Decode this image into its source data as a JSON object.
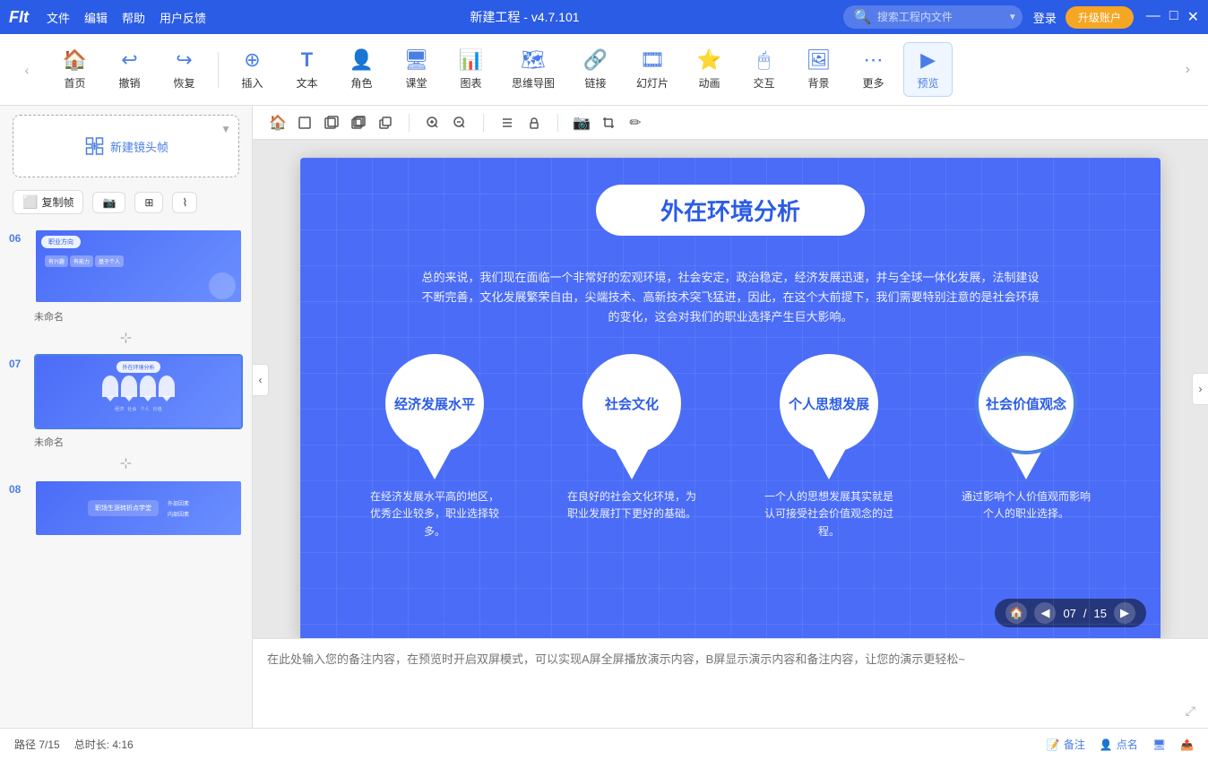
{
  "app": {
    "logo": "FIt",
    "title": "新建工程 - v4.7.101",
    "search_placeholder": "搜索工程内文件",
    "login": "登录",
    "upgrade": "升级账户"
  },
  "window_controls": {
    "minimize": "—",
    "maximize": "□",
    "close": "✕"
  },
  "toolbar": {
    "back": "‹",
    "forward": "›",
    "home_icon": "🏠",
    "home_label": "首页",
    "undo_icon": "↩",
    "undo_label": "撤销",
    "redo_icon": "↪",
    "redo_label": "恢复",
    "insert_icon": "⊕",
    "insert_label": "插入",
    "text_icon": "T",
    "text_label": "文本",
    "character_icon": "👤",
    "character_label": "角色",
    "class_icon": "🖥",
    "class_label": "课堂",
    "chart_icon": "📊",
    "chart_label": "图表",
    "mindmap_icon": "🗺",
    "mindmap_label": "思维导图",
    "link_icon": "🔗",
    "link_label": "链接",
    "slide_icon": "🎞",
    "slide_label": "幻灯片",
    "animation_icon": "⭐",
    "animation_label": "动画",
    "interact_icon": "🖱",
    "interact_label": "交互",
    "bg_icon": "🖼",
    "bg_label": "背景",
    "more_icon": "⋯",
    "more_label": "更多",
    "preview_icon": "▶",
    "preview_label": "预览",
    "right_arrow": "›"
  },
  "canvas_toolbar": {
    "icons": [
      "🏠",
      "⬜",
      "⬜",
      "⬜",
      "⬜",
      "🔍+",
      "🔍-",
      "≡",
      "🔒",
      "📷",
      "📋",
      "✏"
    ]
  },
  "sidebar": {
    "add_frame_label": "新建镜头帧",
    "copy_btn": "复制帧",
    "camera_btn": "📷",
    "resize_btn": "⊞",
    "mask_btn": "⌇",
    "slides": [
      {
        "number": "06",
        "label": "未命名",
        "active": false
      },
      {
        "number": "07",
        "label": "未命名",
        "active": true
      },
      {
        "number": "08",
        "label": "",
        "active": false
      }
    ]
  },
  "slide": {
    "number": "7",
    "title": "外在环境分析",
    "subtitle": "总的来说，我们现在面临一个非常好的宏观环境，社会安定，政治稳定，经济发展迅速，并与全球一体化发展，法制建设不断完善，文化发展繁荣自由，尖端技术、高新技术突飞猛进，因此，在这个大前提下，我们需要特别注意的是社会环境的变化，这会对我们的职业选择产生巨大影响。",
    "pins": [
      {
        "label": "经济发展水平",
        "desc": "在经济发展水平高的地区，优秀企业较多，职业选择较多。"
      },
      {
        "label": "社会文化",
        "desc": "在良好的社会文化环境，为职业发展打下更好的基础。"
      },
      {
        "label": "个人思想发展",
        "desc": "一个人的思想发展其实就是认可接受社会价值观念的过程。"
      },
      {
        "label": "社会价值观念",
        "desc": "通过影响个人价值观而影响个人的职业选择。",
        "selected": true
      }
    ],
    "page_current": "07",
    "page_total": "15"
  },
  "notes": {
    "placeholder": "在此处输入您的备注内容，在预览时开启双屏模式，可以实现A屏全屏播放演示内容，B屏显示演示内容和备注内容，让您的演示更轻松~"
  },
  "status": {
    "path": "路径 7/15",
    "duration": "总时长: 4:16",
    "notes_btn": "备注",
    "roll_btn": "点名",
    "screen_btn": "🖥",
    "share_btn": "📤"
  }
}
